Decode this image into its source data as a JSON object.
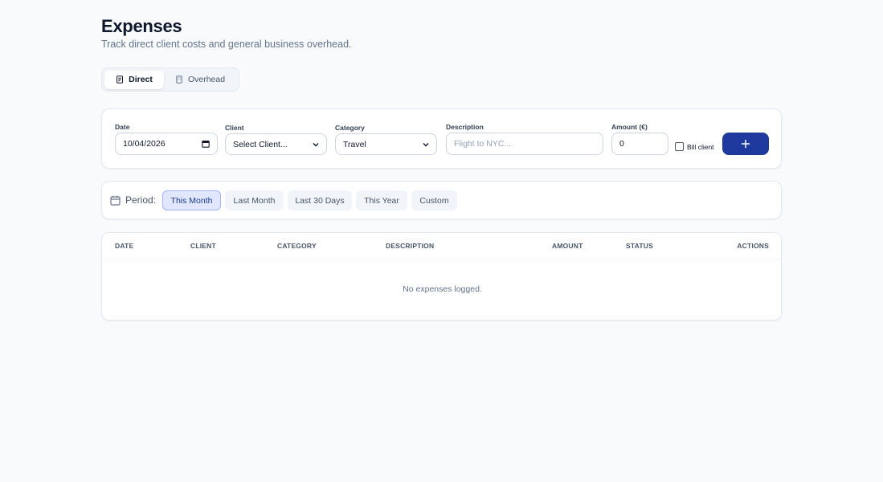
{
  "header": {
    "title": "Expenses",
    "subtitle": "Track direct client costs and general business overhead."
  },
  "tabs": [
    {
      "label": "Direct",
      "icon": "receipt-icon",
      "active": true
    },
    {
      "label": "Overhead",
      "icon": "building-icon",
      "active": false
    }
  ],
  "form": {
    "date": {
      "label": "Date",
      "value": "10/04/2026"
    },
    "client": {
      "label": "Client",
      "value": "Select Client..."
    },
    "category": {
      "label": "Category",
      "value": "Travel"
    },
    "description": {
      "label": "Description",
      "placeholder": "Flight to NYC..."
    },
    "amount": {
      "label": "Amount (€)",
      "value": "0"
    },
    "bill_client": {
      "label": "Bill client",
      "checked": false
    },
    "add_button_icon": "plus-icon"
  },
  "period": {
    "label": "Period:",
    "options": [
      {
        "label": "This Month",
        "active": true
      },
      {
        "label": "Last Month",
        "active": false
      },
      {
        "label": "Last 30 Days",
        "active": false
      },
      {
        "label": "This Year",
        "active": false
      },
      {
        "label": "Custom",
        "active": false
      }
    ]
  },
  "table": {
    "columns": [
      "DATE",
      "CLIENT",
      "CATEGORY",
      "DESCRIPTION",
      "AMOUNT",
      "STATUS",
      "ACTIONS"
    ],
    "empty_message": "No expenses logged."
  },
  "colors": {
    "primary": "#1e3a9e",
    "background": "#f8fafc",
    "active_pill": "#e0e7ff"
  }
}
